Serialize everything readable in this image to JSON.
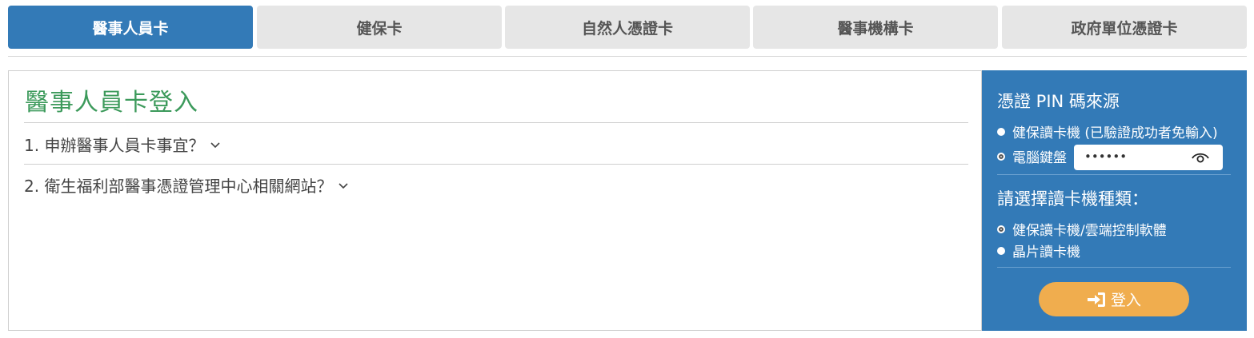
{
  "tabs": [
    {
      "label": "醫事人員卡",
      "active": true
    },
    {
      "label": "健保卡",
      "active": false
    },
    {
      "label": "自然人憑證卡",
      "active": false
    },
    {
      "label": "醫事機構卡",
      "active": false
    },
    {
      "label": "政府單位憑證卡",
      "active": false
    }
  ],
  "main": {
    "title": "醫事人員卡登入",
    "faq": [
      {
        "label": "1. 申辦醫事人員卡事宜？"
      },
      {
        "label": "2. 衛生福利部醫事憑證管理中心相關網站？"
      }
    ]
  },
  "side": {
    "pin_source_title": "憑證 PIN 碼來源",
    "pin_options": [
      {
        "label": "健保讀卡機 (已驗證成功者免輸入)",
        "selected": false
      },
      {
        "label": "電腦鍵盤",
        "selected": true
      }
    ],
    "pin_value": "••••••",
    "reader_title": "請選擇讀卡機種類：",
    "reader_options": [
      {
        "label": "健保讀卡機/雲端控制軟體",
        "selected": true
      },
      {
        "label": "晶片讀卡機",
        "selected": false
      }
    ],
    "login_label": "登入"
  },
  "colors": {
    "primary": "#337ab7",
    "title_green": "#3c9a5b",
    "login_orange": "#f0ad4e",
    "tab_inactive": "#e6e6e6"
  }
}
